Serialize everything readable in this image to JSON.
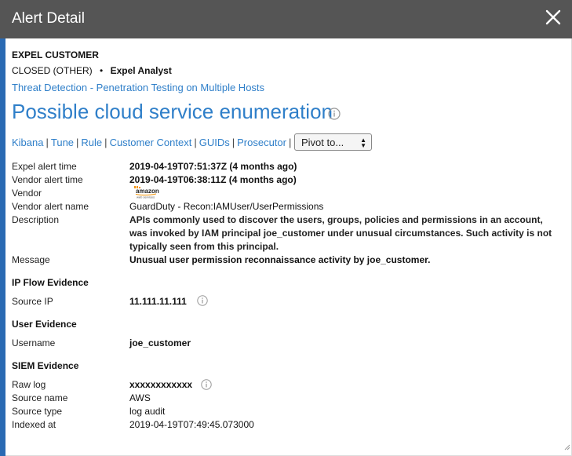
{
  "window": {
    "title": "Alert Detail",
    "close_icon": "close-icon"
  },
  "customer": "EXPEL CUSTOMER",
  "status": {
    "state": "CLOSED (OTHER)",
    "separator": "•",
    "assignee": "Expel Analyst"
  },
  "investigation_link": "Threat Detection - Penetration Testing on Multiple Hosts",
  "alert_title": "Possible cloud service enumeration",
  "links": [
    "Kibana",
    "Tune",
    "Rule",
    "Customer Context",
    "GUIDs",
    "Prosecutor"
  ],
  "link_separator": "|",
  "pivot": {
    "selected": "Pivot to..."
  },
  "fields": {
    "expel_alert_time": {
      "label": "Expel alert time",
      "value": "2019-04-19T07:51:37Z (4 months ago)"
    },
    "vendor_alert_time": {
      "label": "Vendor alert time",
      "value": "2019-04-19T06:38:11Z (4 months ago)"
    },
    "vendor": {
      "label": "Vendor",
      "logo": "amazon",
      "logo_text": "amazon",
      "logo_subtext": "web services"
    },
    "vendor_alert_name": {
      "label": "Vendor alert name",
      "value": "GuardDuty - Recon:IAMUser/UserPermissions"
    },
    "description": {
      "label": "Description",
      "value": "APIs commonly used to discover the users, groups, policies and permissions in an account, was invoked by IAM principal joe_customer under unusual circumstances. Such activity is not typically seen from this principal."
    },
    "message": {
      "label": "Message",
      "value": "Unusual user permission reconnaissance activity by joe_customer."
    }
  },
  "ip_flow": {
    "heading": "IP Flow Evidence",
    "source_ip_label": "Source IP",
    "source_ip": "11.111.11.111"
  },
  "user": {
    "heading": "User Evidence",
    "username_label": "Username",
    "username": "joe_customer"
  },
  "siem": {
    "heading": "SIEM Evidence",
    "raw_log_label": "Raw log",
    "raw_log": "xxxxxxxxxxxx",
    "source_name_label": "Source name",
    "source_name": "AWS",
    "source_type_label": "Source type",
    "source_type": "log audit",
    "indexed_at_label": "Indexed at",
    "indexed_at": "2019-04-19T07:49:45.073000"
  },
  "colors": {
    "titlebar": "#555555",
    "accent": "#2f7fc9",
    "left_bar": "#2a6ab3"
  }
}
